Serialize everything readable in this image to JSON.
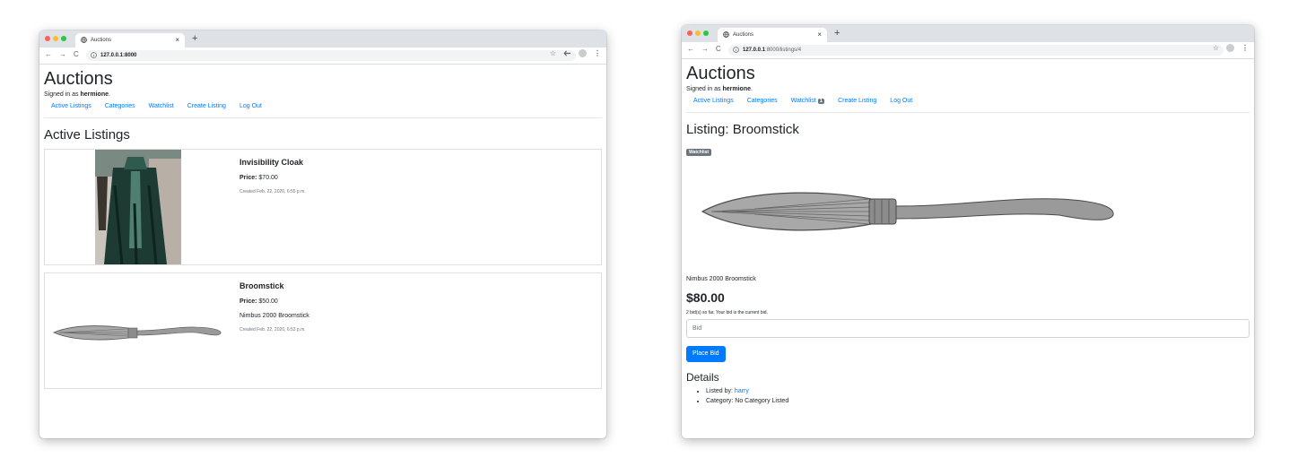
{
  "colors": {
    "accent": "#007bff",
    "badge": "#6c757d",
    "traffic_red": "#fe5f57",
    "traffic_yellow": "#febc2e",
    "traffic_green": "#28c840"
  },
  "browser": {
    "tab_title": "Auctions",
    "tab_close": "×",
    "new_tab": "+",
    "back": "←",
    "forward": "→",
    "reload": "C",
    "star": "☆",
    "menu": "⋮"
  },
  "window1": {
    "url_host": "127.0.0.1:8000",
    "url_path": "",
    "site_title": "Auctions",
    "signed_in_prefix": "Signed in as ",
    "username": "hermione",
    "signed_in_suffix": ".",
    "nav": {
      "active_listings": "Active Listings",
      "categories": "Categories",
      "watchlist": "Watchlist",
      "create_listing": "Create Listing",
      "log_out": "Log Out"
    },
    "section_title": "Active Listings",
    "listings": [
      {
        "title": "Invisibility Cloak",
        "price_label": "Price:",
        "price": " $70.00",
        "description": "",
        "created": "Created Feb. 22, 2020, 6:55 p.m."
      },
      {
        "title": "Broomstick",
        "price_label": "Price:",
        "price": " $50.00",
        "description": "Nimbus 2000 Broomstick",
        "created": "Created Feb. 22, 2020, 6:53 p.m."
      }
    ]
  },
  "window2": {
    "url_host": "127.0.0.1",
    "url_path": ":8000/listings/4",
    "site_title": "Auctions",
    "signed_in_prefix": "Signed in as ",
    "username": "hermione",
    "signed_in_suffix": ".",
    "nav": {
      "active_listings": "Active Listings",
      "categories": "Categories",
      "watchlist": "Watchlist",
      "watchlist_count": "1",
      "create_listing": "Create Listing",
      "log_out": "Log Out"
    },
    "listing_heading": "Listing: Broomstick",
    "watchlist_badge": "Watchlist",
    "description": "Nimbus 2000 Broomstick",
    "price": "$80.00",
    "bid_info": "2 bid(s) so far. Your bid is the current bid.",
    "bid_placeholder": "Bid",
    "place_bid": "Place Bid",
    "details_heading": "Details",
    "listed_by_label": "Listed by: ",
    "listed_by_user": "harry",
    "category_text": "Category: No Category Listed"
  }
}
